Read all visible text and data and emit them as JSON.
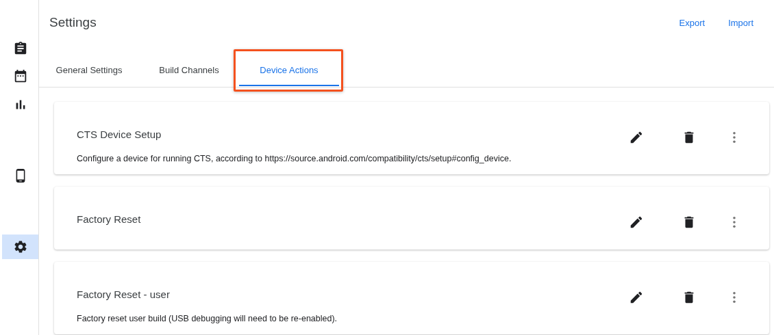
{
  "sidebar": {
    "groups": [
      [
        {
          "kind": "clipboard",
          "selected": false
        },
        {
          "kind": "calendar",
          "selected": false
        },
        {
          "kind": "chart",
          "selected": false
        }
      ],
      [
        {
          "kind": "phone",
          "selected": false
        }
      ],
      [
        {
          "kind": "gear",
          "selected": true
        }
      ]
    ]
  },
  "header": {
    "title": "Settings",
    "actions": [
      "Export",
      "Import"
    ]
  },
  "tabs": [
    {
      "label": "General Settings",
      "selected": false,
      "highlighted": false
    },
    {
      "label": "Build Channels",
      "selected": false,
      "highlighted": false
    },
    {
      "label": "Device Actions",
      "selected": true,
      "highlighted": true
    }
  ],
  "actions": [
    {
      "title": "CTS Device Setup",
      "description": "Configure a device for running CTS, according to https://source.android.com/compatibility/cts/setup#config_device."
    },
    {
      "title": "Factory Reset"
    },
    {
      "title": "Factory Reset - user",
      "description": "Factory reset user build (USB debugging will need to be re-enabled)."
    }
  ]
}
